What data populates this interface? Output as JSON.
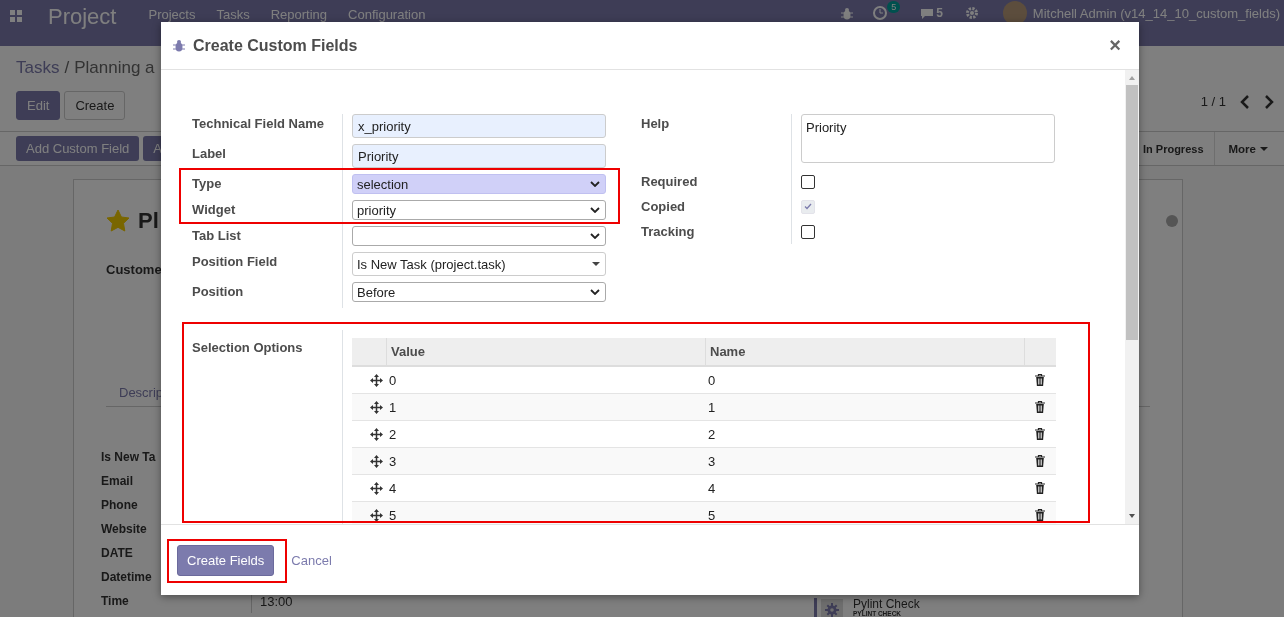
{
  "navbar": {
    "app_title": "Project",
    "menu": [
      "Projects",
      "Tasks",
      "Reporting",
      "Configuration"
    ],
    "activity_count": "5",
    "message_count": "5",
    "user": "Mitchell Admin (v14_14_10_custom_fields)"
  },
  "control_panel": {
    "breadcrumb": [
      "Tasks",
      "/",
      "Planning a"
    ],
    "buttons": [
      {
        "label": "Edit",
        "kind": "primary"
      },
      {
        "label": "Create",
        "kind": "secondary"
      }
    ],
    "pager": "1 / 1"
  },
  "statusbar": {
    "buttons": [
      "Add Custom Field",
      "A"
    ],
    "stages": [
      "In Progress"
    ],
    "more": "More"
  },
  "form": {
    "starred": true,
    "title": "Pl",
    "customer_label": "Custome",
    "tab": "Descrip",
    "fields": [
      {
        "label": "Is New Ta"
      },
      {
        "label": "Email"
      },
      {
        "label": "Phone"
      },
      {
        "label": "Website"
      },
      {
        "label": "DATE"
      },
      {
        "label": "Datetime"
      },
      {
        "label": "Time",
        "value": "13:00"
      }
    ],
    "side_item": {
      "title": "Pylint Check",
      "subtitle": "PYLINT CHECK"
    }
  },
  "dialog": {
    "title": "Create Custom Fields",
    "close": "×",
    "left_fields": [
      {
        "label": "Technical Field Name",
        "kind": "text",
        "value": "x_priority",
        "focused": false
      },
      {
        "label": "Label",
        "kind": "text",
        "value": "Priority",
        "focused": false
      },
      {
        "label": "Type",
        "kind": "select",
        "value": "selection",
        "focused": true
      },
      {
        "label": "Widget",
        "kind": "select",
        "value": "priority",
        "focused": false
      },
      {
        "label": "Tab List",
        "kind": "select",
        "focused": false
      },
      {
        "label": "Position Field",
        "kind": "many2one",
        "value": "Is New Task (project.task)",
        "focused": false
      },
      {
        "label": "Position",
        "kind": "select",
        "value": "Before",
        "focused": false
      }
    ],
    "right_fields": [
      {
        "label": "Help",
        "kind": "textarea",
        "value": "Priority"
      },
      {
        "label": "Required",
        "kind": "checkbox",
        "checked": false,
        "disabled": false
      },
      {
        "label": "Copied",
        "kind": "checkbox",
        "checked": true,
        "disabled": true
      },
      {
        "label": "Tracking",
        "kind": "checkbox",
        "checked": false,
        "disabled": false
      }
    ],
    "selection_options": {
      "label": "Selection Options",
      "columns": [
        "Value",
        "Name"
      ],
      "rows": [
        {
          "value": "0",
          "name": "0"
        },
        {
          "value": "1",
          "name": "1"
        },
        {
          "value": "2",
          "name": "2"
        },
        {
          "value": "3",
          "name": "3"
        },
        {
          "value": "4",
          "name": "4"
        },
        {
          "value": "5",
          "name": "5"
        }
      ]
    },
    "footer": {
      "primary": "Create Fields",
      "cancel": "Cancel"
    }
  }
}
